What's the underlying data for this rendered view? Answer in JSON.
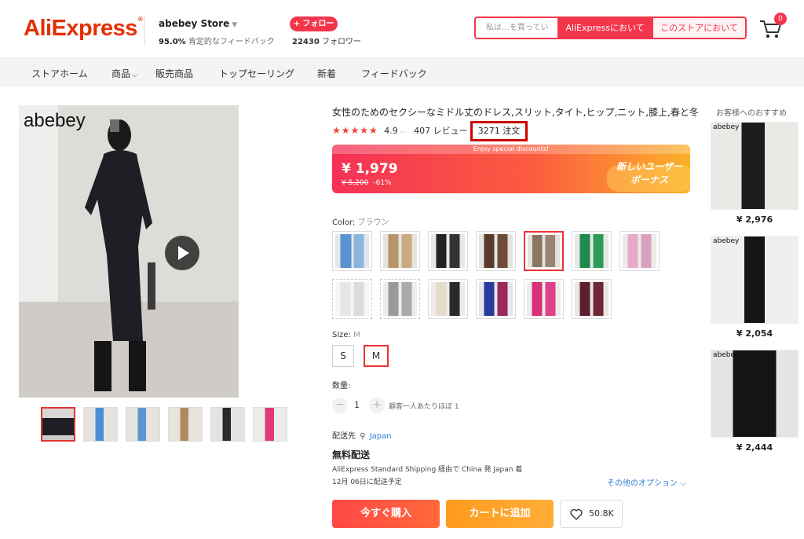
{
  "header": {
    "logo": "AliExpress",
    "store_name": "abebey Store",
    "feedback_pct": "95.0%",
    "feedback_label": "肯定的なフィードバック",
    "follow_label": "+ フォロー",
    "followers_count": "22430",
    "followers_label": "フォロワー",
    "search_placeholder": "私は…を買ってい",
    "search_all_label": "AliExpressにおいて",
    "search_store_label": "このストアにおいて",
    "cart_count": "0"
  },
  "nav": {
    "items": [
      "ストアホーム",
      "商品",
      "販売商品",
      "トップセーリング",
      "新着",
      "フィードバック"
    ]
  },
  "gallery": {
    "brand": "abebey"
  },
  "product": {
    "title": "女性のためのセクシーなミドル丈のドレス,スリット,タイト,ヒップ,ニット,膝上,春と冬",
    "stars": "★★★★★",
    "rating": "4.9",
    "reviews": "407 レビュー",
    "orders": "3271 注文",
    "promo_strip": "Enjoy special discounts!",
    "price": "¥ 1,979",
    "old_price": "¥ 5,200",
    "discount": "-61%",
    "new_user_promo": "新しいユーザーボーナス",
    "color_label": "Color:",
    "color_value": "ブラウン",
    "size_label": "Size:",
    "size_value": "M",
    "sizes": [
      "S",
      "M"
    ],
    "quantity_label": "数量:",
    "quantity": "1",
    "quantity_note": "顧客一人あたりほぼ 1",
    "ship_to_label": "配送先",
    "ship_to": "Japan",
    "free_shipping": "無料配送",
    "shipping_detail": "AliExpress Standard Shipping 経由で China 発 Japan 着",
    "delivery_date": "12月 06日に配送予定",
    "more_options": "その他のオプション",
    "buy_now": "今すぐ購入",
    "add_to_cart": "カートに追加",
    "wishlist_count": "50.8K"
  },
  "recommendations": {
    "title": "お客様へのおすすめ",
    "brand": "abebey",
    "items": [
      {
        "price": "¥ 2,976"
      },
      {
        "price": "¥ 2,054"
      },
      {
        "price": "¥ 2,444"
      }
    ]
  },
  "colors": {
    "accent": "#f4364c",
    "logo": "#e62e04",
    "link": "#2e7dd4",
    "selected_border": "#e33333"
  }
}
